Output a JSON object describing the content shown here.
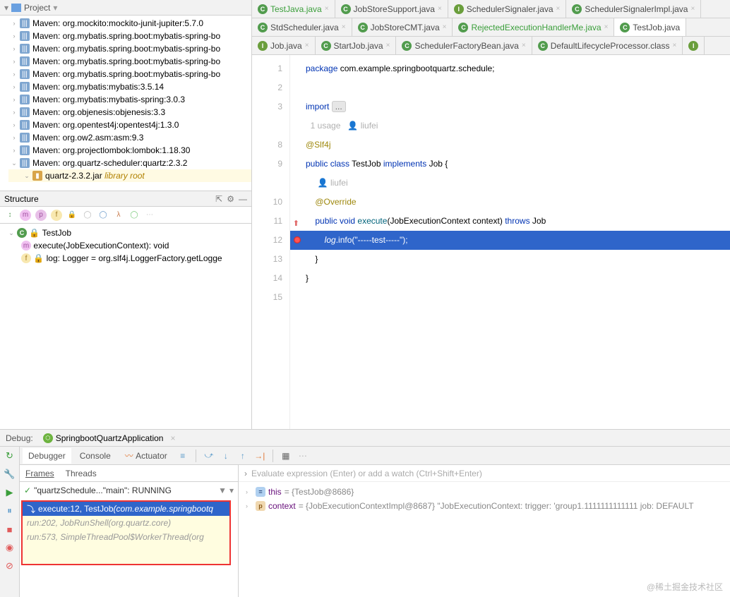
{
  "project": {
    "title": "Project",
    "maven_items": [
      "Maven: org.mockito:mockito-junit-jupiter:5.7.0",
      "Maven: org.mybatis.spring.boot:mybatis-spring-bo",
      "Maven: org.mybatis.spring.boot:mybatis-spring-bo",
      "Maven: org.mybatis.spring.boot:mybatis-spring-bo",
      "Maven: org.mybatis.spring.boot:mybatis-spring-bo",
      "Maven: org.mybatis:mybatis:3.5.14",
      "Maven: org.mybatis:mybatis-spring:3.0.3",
      "Maven: org.objenesis:objenesis:3.3",
      "Maven: org.opentest4j:opentest4j:1.3.0",
      "Maven: org.ow2.asm:asm:9.3",
      "Maven: org.projectlombok:lombok:1.18.30",
      "Maven: org.quartz-scheduler:quartz:2.3.2"
    ],
    "jar_label": "quartz-2.3.2.jar",
    "libroot": "library root"
  },
  "structure": {
    "title": "Structure",
    "class_name": "TestJob",
    "method": "execute(JobExecutionContext): void",
    "field": "log: Logger = org.slf4j.LoggerFactory.getLogge"
  },
  "tabs_row1": [
    {
      "icon": "c",
      "label": "TestJava.java",
      "close": true
    },
    {
      "icon": "c",
      "label": "JobStoreSupport.java",
      "close": true
    },
    {
      "icon": "i",
      "label": "SchedulerSignaler.java",
      "close": true
    },
    {
      "icon": "c",
      "label": "SchedulerSignalerImpl.java",
      "close": true
    }
  ],
  "tabs_row2": [
    {
      "icon": "c",
      "label": "StdScheduler.java",
      "close": true
    },
    {
      "icon": "c",
      "label": "JobStoreCMT.java",
      "close": true
    },
    {
      "icon": "c",
      "label": "RejectedExecutionHandlerMe.java",
      "close": true,
      "color": "#3a9e3a"
    },
    {
      "icon": "c",
      "label": "TestJob.java",
      "close": false,
      "active": true
    }
  ],
  "tabs_row3": [
    {
      "icon": "i",
      "label": "Job.java",
      "close": true
    },
    {
      "icon": "c",
      "label": "StartJob.java",
      "close": true
    },
    {
      "icon": "c",
      "label": "SchedulerFactoryBean.java",
      "close": true
    },
    {
      "icon": "c",
      "label": "DefaultLifecycleProcessor.class",
      "close": true
    },
    {
      "icon": "i",
      "label": "",
      "close": false
    }
  ],
  "editor": {
    "line1_kw": "package",
    "line1_rest": " com.example.springbootquartz.schedule;",
    "line3_kw": "import",
    "line3_fold": "...",
    "usages": "1 usage",
    "author": "liufei",
    "slf4j": "@Slf4j",
    "pub": "public",
    "cls_kw": "class",
    "cls_name": "TestJob",
    "impl": "implements",
    "iface": "Job",
    "author2": "liufei",
    "override": "@Override",
    "void": "void",
    "exec": "execute",
    "param": "JobExecutionContext context",
    "throws": "throws",
    "exc": "Job",
    "log_obj": "log",
    "info": ".info",
    "str": "\"-----test-----\"",
    "lines": [
      "1",
      "2",
      "3",
      "",
      "8",
      "9",
      "",
      "10",
      "11",
      "12",
      "13",
      "14",
      "15"
    ]
  },
  "debug": {
    "label": "Debug:",
    "app": "SpringbootQuartzApplication",
    "tabs": [
      "Debugger",
      "Console",
      "Actuator"
    ],
    "frames_tab": "Frames",
    "threads_tab": "Threads",
    "thread": "\"quartzSchedule...\"main\": RUNNING",
    "frame0": {
      "pre": "execute:12, TestJob ",
      "pkg": "(com.example.springbootq"
    },
    "frame1": {
      "pre": "run:202, JobRunShell ",
      "pkg": "(org.quartz.core)"
    },
    "frame2": {
      "pre": "run:573, SimpleThreadPool$WorkerThread ",
      "pkg": "(org"
    },
    "eval_placeholder": "Evaluate expression (Enter) or add a watch (Ctrl+Shift+Enter)",
    "var_this": {
      "name": "this",
      "val": " = {TestJob@8686}"
    },
    "var_ctx": {
      "name": "context",
      "val": " = {JobExecutionContextImpl@8687} \"JobExecutionContext: trigger: 'group1.1111111111111 job: DEFAULT"
    }
  },
  "watermark": "@稀土掘金技术社区"
}
